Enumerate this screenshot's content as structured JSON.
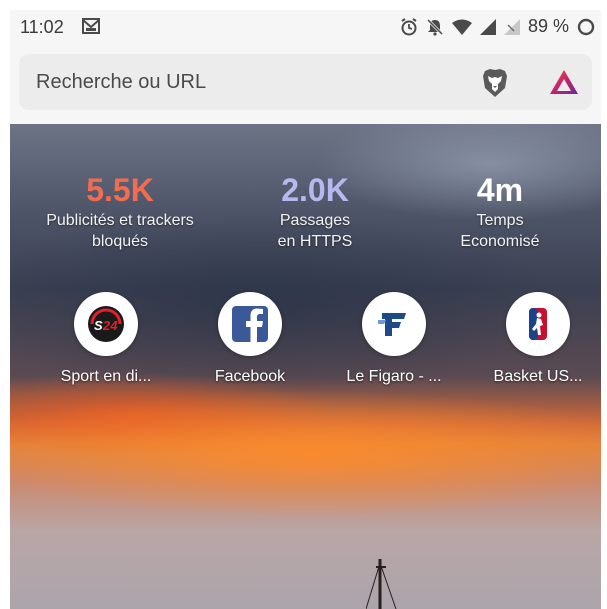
{
  "status_bar": {
    "time": "11:02",
    "battery": "89 %",
    "icons": [
      "gmail-icon",
      "alarm-icon",
      "do-not-disturb-icon",
      "wifi-icon",
      "signal-icon",
      "no-sim-icon",
      "battery-ring-icon"
    ]
  },
  "url_bar": {
    "placeholder": "Recherche ou URL",
    "icons": [
      "brave-shield-icon",
      "brave-rewards-icon"
    ]
  },
  "stats": [
    {
      "value": "5.5K",
      "label_line1": "Publicités et trackers",
      "label_line2": "bloqués",
      "color": "#f26c4f"
    },
    {
      "value": "2.0K",
      "label_line1": "Passages",
      "label_line2": "en HTTPS",
      "color": "#b7b8f0"
    },
    {
      "value": "4m",
      "label_line1": "Temps",
      "label_line2": "Economisé",
      "color": "#ffffff"
    }
  ],
  "top_sites": [
    {
      "label": "Sport en di...",
      "icon": "sport24-icon"
    },
    {
      "label": "Facebook",
      "icon": "facebook-icon"
    },
    {
      "label": "Le Figaro - ...",
      "icon": "le-figaro-icon"
    },
    {
      "label": "Basket US...",
      "icon": "basket-us-icon"
    }
  ],
  "colors": {
    "brave_orange": "#fb542b",
    "facebook_blue": "#3b5998"
  }
}
